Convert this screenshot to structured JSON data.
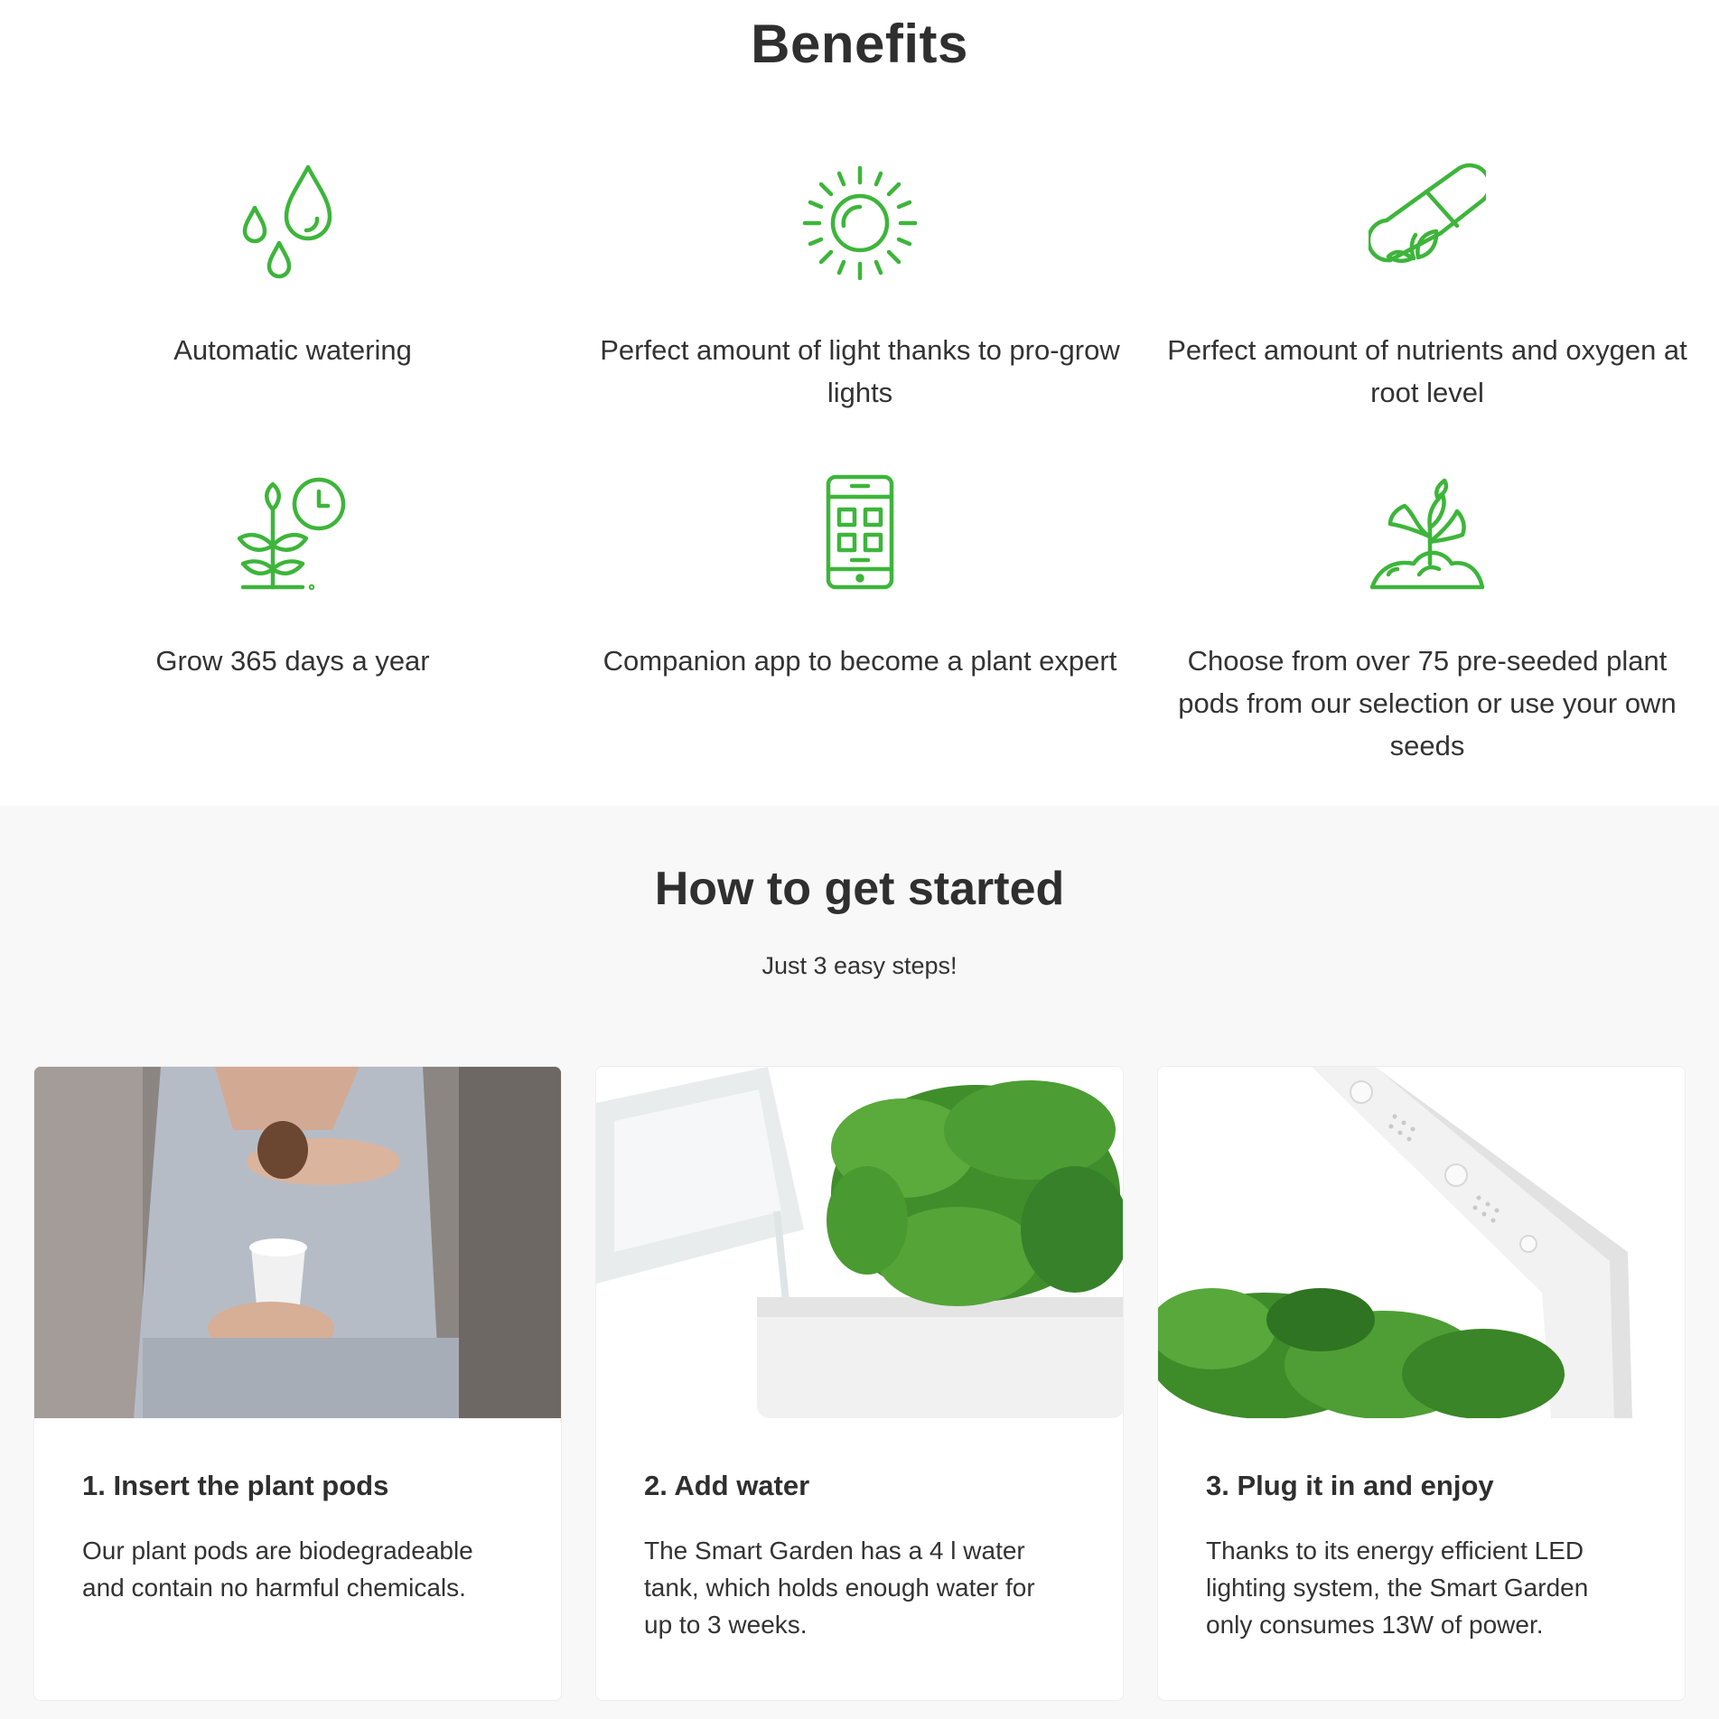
{
  "benefits": {
    "title": "Benefits",
    "accent_color": "#3db53a",
    "items": [
      {
        "icon": "water-drops-icon",
        "label": "Automatic watering"
      },
      {
        "icon": "sun-icon",
        "label": "Perfect amount of light thanks to pro-grow lights"
      },
      {
        "icon": "nutrient-capsule-icon",
        "label": "Perfect amount of nutrients and oxygen at root level"
      },
      {
        "icon": "plant-clock-icon",
        "label": "Grow 365 days a year"
      },
      {
        "icon": "smartphone-app-icon",
        "label": "Companion app to become a plant expert"
      },
      {
        "icon": "sprout-soil-icon",
        "label": "Choose from over 75 pre-seeded plant pods from our selection or use your own seeds"
      }
    ]
  },
  "get_started": {
    "title": "How to get started",
    "subtitle": "Just 3 easy steps!",
    "steps": [
      {
        "title": "1. Insert the plant pods",
        "text": "Our plant pods are biodegradeable and contain no harmful chemicals."
      },
      {
        "title": "2. Add water",
        "text": "The Smart Garden has a 4 l water tank, which holds enough water for up to 3 weeks."
      },
      {
        "title": "3. Plug it in and enjoy",
        "text": "Thanks to its energy efficient LED lighting system, the Smart Garden only consumes 13W of power."
      }
    ]
  }
}
